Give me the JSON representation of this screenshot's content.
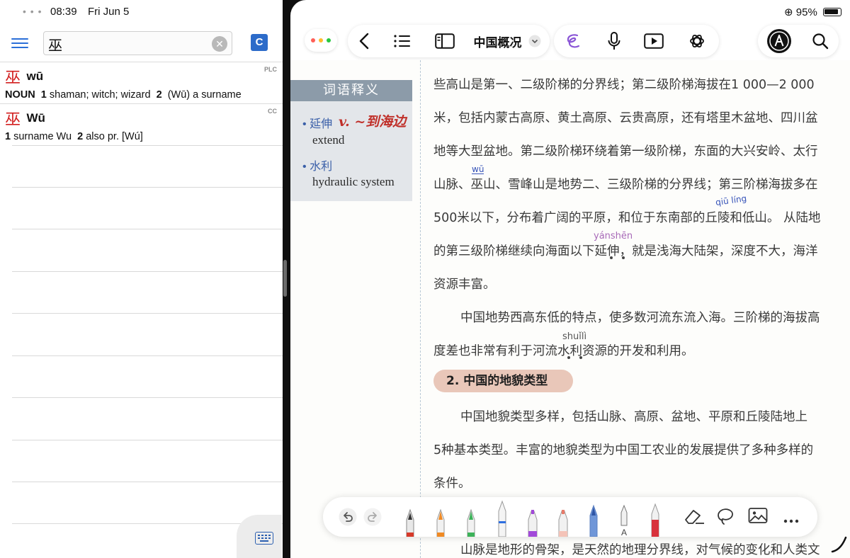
{
  "status_left": {
    "time": "08:39",
    "date": "Fri Jun 5"
  },
  "status_right": {
    "battery": "95%"
  },
  "dictionary": {
    "search": {
      "value": "巫",
      "placeholder": ""
    },
    "c_label": "C",
    "entries": [
      {
        "hanzi": "巫",
        "pinyin": "wū",
        "source": "PLC",
        "pos": "NOUN",
        "def_1": "shaman; witch; wizard",
        "def_2": "(Wū) a surname"
      },
      {
        "hanzi": "巫",
        "pinyin": "Wū",
        "source": "CC",
        "def_1": "surname Wu",
        "def_2": "also pr. [Wú]"
      }
    ]
  },
  "notes": {
    "title": "中国概况",
    "vocab": {
      "heading": "词语释义",
      "items": [
        {
          "zh": "延伸",
          "en": "extend",
          "handwritten": "v. ~到海边"
        },
        {
          "zh": "水利",
          "en": "hydraulic system"
        }
      ]
    },
    "lines": [
      "些高山是第一、二级阶梯的分界线；第二级阶梯海拔在1 000—2 000",
      "米，包括内蒙古高原、黄土高原、云贵高原，还有塔里木盆地、四川盆",
      "地等大型盆地。第二级阶梯环绕着第一级阶梯，东面的大兴安岭、太行",
      "山脉、巫山、雪峰山是地势二、三级阶梯的分界线；第三阶梯海拔多在",
      "500米以下，分布着广阔的平原，和位于东南部的丘陵和低山。 从陆地",
      "的第三级阶梯继续向海面以下延伸，就是浅海大陆架，深度不大，海洋",
      "资源丰富。",
      "中国地势西高东低的特点，使多数河流东流入海。三阶梯的海拔高",
      "度差也非常有利于河流水利资源的开发和利用。",
      "中国地貌类型多样，包括山脉、高原、盆地、平原和丘陵陆地上",
      "5种基本类型。丰富的地貌类型为中国工农业的发展提供了多种多样的",
      "条件。",
      "山脉是地形的骨架，是天然的地理分界线，对气候的变化和人类文"
    ],
    "section_heading": "2. 中国的地貌类型",
    "annotations": {
      "wu": "wū",
      "qiuling": "qiū líng",
      "yanshen": "yánshēn",
      "shuili": "shuǐlì"
    }
  },
  "colors": {
    "dictionary_accent": "#2b6fd8",
    "hanzi_red": "#d21f1f",
    "section_pill": "#e9c7b9",
    "vocab_header": "#8c9ba9"
  }
}
